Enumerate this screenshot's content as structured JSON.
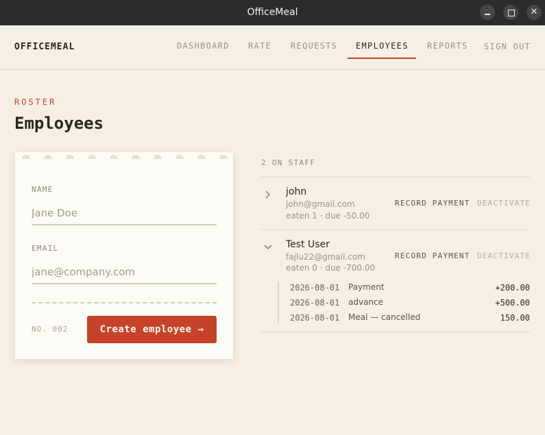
{
  "window": {
    "title": "OfficeMeal"
  },
  "brand": "OFFICEMEAL",
  "nav": {
    "dashboard": "DASHBOARD",
    "rate": "RATE",
    "requests": "REQUESTS",
    "employees": "EMPLOYEES",
    "reports": "REPORTS",
    "signout": "SIGN OUT",
    "active": "EMPLOYEES"
  },
  "page": {
    "eyebrow": "ROSTER",
    "title": "Employees"
  },
  "form": {
    "name_label": "NAME",
    "name_placeholder": "Jane Doe",
    "name_value": "",
    "email_label": "EMAIL",
    "email_placeholder": "jane@company.com",
    "email_value": "",
    "serial": "NO. 002",
    "submit_label": "Create employee →"
  },
  "staff": {
    "count_label": "2 ON STAFF",
    "employees": [
      {
        "name": "john",
        "email": "john@gmail.com",
        "summary": "eaten 1 · due -50.00",
        "expanded": false,
        "record_label": "RECORD PAYMENT",
        "deactivate_label": "DEACTIVATE"
      },
      {
        "name": "Test User",
        "email": "fajlu22@gmail.com",
        "summary": "eaten 0 · due -700.00",
        "expanded": true,
        "record_label": "RECORD PAYMENT",
        "deactivate_label": "DEACTIVATE",
        "ledger": [
          {
            "date": "2026-08-01",
            "desc": "Payment",
            "amount": "+200.00"
          },
          {
            "date": "2026-08-01",
            "desc": "advance",
            "amount": "+500.00"
          },
          {
            "date": "2026-08-01",
            "desc": "Meal — cancelled",
            "amount": "150.00"
          }
        ]
      }
    ]
  },
  "colors": {
    "accent": "#c4432a",
    "background": "#f6efe4",
    "card": "#fdfbf5",
    "titlebar": "#2c2c2c"
  }
}
